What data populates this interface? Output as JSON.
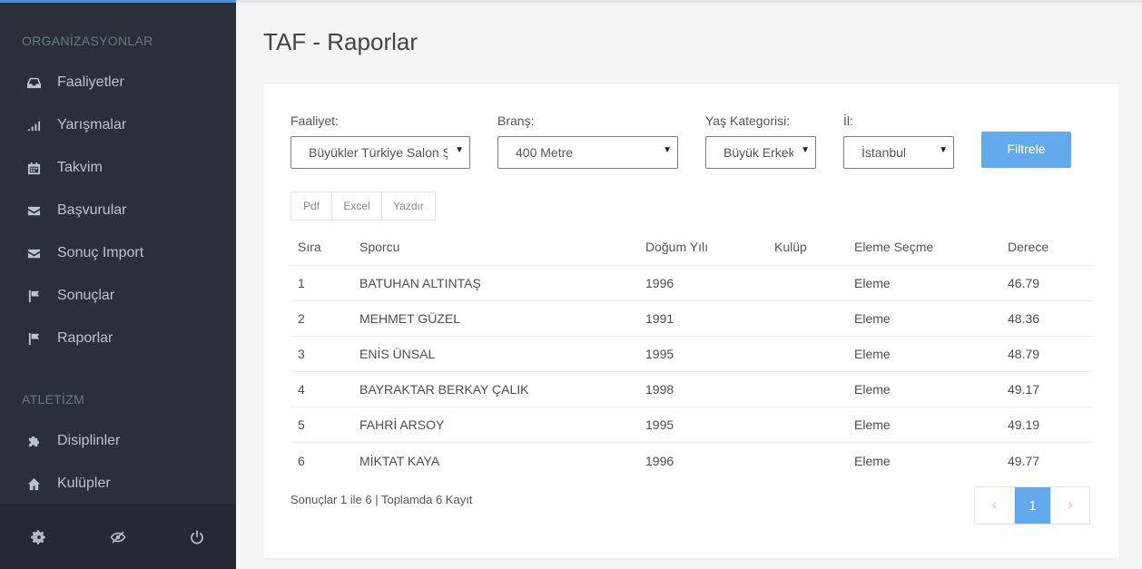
{
  "sidebar": {
    "heading1": "ORGANİZASYONLAR",
    "group1": [
      {
        "label": "Faaliyetler",
        "icon": "inbox-icon"
      },
      {
        "label": "Yarışmalar",
        "icon": "signal-icon"
      },
      {
        "label": "Takvim",
        "icon": "calendar-icon"
      },
      {
        "label": "Başvurular",
        "icon": "envelope-icon"
      },
      {
        "label": "Sonuç Import",
        "icon": "envelope-icon"
      },
      {
        "label": "Sonuçlar",
        "icon": "flag-icon"
      },
      {
        "label": "Raporlar",
        "icon": "flag-icon"
      }
    ],
    "heading2": "ATLETİZM",
    "group2": [
      {
        "label": "Disiplinler",
        "icon": "puzzle-icon"
      },
      {
        "label": "Kulüpler",
        "icon": "home-icon"
      }
    ],
    "footer": [
      "gear-icon",
      "eye-slash-icon",
      "power-icon"
    ]
  },
  "page": {
    "title": "TAF - Raporlar"
  },
  "filters": {
    "faaliyet": {
      "label": "Faaliyet:",
      "value": "Büyükler Türkiye Salon Şampiyonası"
    },
    "brans": {
      "label": "Branş:",
      "value": "400 Metre"
    },
    "yas": {
      "label": "Yaş Kategorisi:",
      "value": "Büyük Erkek"
    },
    "il": {
      "label": "İl:",
      "value": "İstanbul"
    },
    "button": "Filtrele"
  },
  "export": [
    "Pdf",
    "Excel",
    "Yazdır"
  ],
  "table": {
    "headers": [
      "Sıra",
      "Sporcu",
      "Doğum Yılı",
      "Kulüp",
      "Eleme Seçme",
      "Derece"
    ],
    "rows": [
      [
        "1",
        "BATUHAN ALTINTAŞ",
        "1996",
        "",
        "Eleme",
        "46.79"
      ],
      [
        "2",
        "MEHMET GÜZEL",
        "1991",
        "",
        "Eleme",
        "48.36"
      ],
      [
        "3",
        "ENİS ÜNSAL",
        "1995",
        "",
        "Eleme",
        "48.79"
      ],
      [
        "4",
        "BAYRAKTAR BERKAY ÇALIK",
        "1998",
        "",
        "Eleme",
        "49.17"
      ],
      [
        "5",
        "FAHRİ ARSOY",
        "1995",
        "",
        "Eleme",
        "49.19"
      ],
      [
        "6",
        "MİKTAT KAYA",
        "1996",
        "",
        "Eleme",
        "49.77"
      ]
    ]
  },
  "footer": {
    "results_info": "Sonuçlar 1 ile 6 | Toplamda 6 Kayıt",
    "pagination": {
      "prev": "‹",
      "current": "1",
      "next": "›"
    }
  },
  "colors": {
    "accent": "#63aaec",
    "sidebar": "#2a3036"
  }
}
